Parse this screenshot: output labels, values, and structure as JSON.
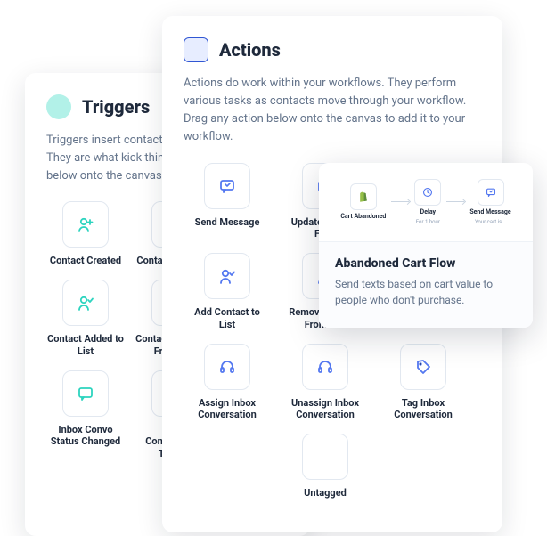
{
  "triggers": {
    "title": "Triggers",
    "desc": "Triggers insert contacts into your workflows. They are what kick things off. Drag any trigger below onto the canvas to add it.",
    "items": [
      {
        "label": "Contact Created",
        "icon": "user-plus"
      },
      {
        "label": "Contact Changed",
        "icon": "user-check"
      },
      {
        "label": "Contact Added to List",
        "icon": "user-check"
      },
      {
        "label": "Contact Removed From List",
        "icon": "user-minus"
      },
      {
        "label": "Inbox Convo Status Changed",
        "icon": "message"
      },
      {
        "label": "Inbox Conversation Tagged",
        "icon": "message-tag"
      }
    ]
  },
  "actions": {
    "title": "Actions",
    "desc": "Actions do work within your workflows. They perform various tasks as contacts move through your workflow. Drag any action below onto the canvas to add it to your workflow.",
    "items": [
      {
        "label": "Send Message",
        "icon": "send-message"
      },
      {
        "label": "Update Contact Field",
        "icon": "edit-field"
      },
      {
        "label": "",
        "icon": ""
      },
      {
        "label": "Add Contact to List",
        "icon": "user-check"
      },
      {
        "label": "Remove Contact From List",
        "icon": "user-minus"
      },
      {
        "label": "",
        "icon": ""
      },
      {
        "label": "Assign Inbox Conversation",
        "icon": "headset"
      },
      {
        "label": "Unassign Inbox Conversation",
        "icon": "headset"
      },
      {
        "label": "Tag Inbox Conversation",
        "icon": "tag"
      },
      {
        "label": "",
        "icon": ""
      },
      {
        "label": "Untagged",
        "icon": ""
      },
      {
        "label": "",
        "icon": ""
      }
    ]
  },
  "flow": {
    "title": "Abandoned Cart Flow",
    "desc": "Send texts based on cart value to people who don't purchase.",
    "nodes": [
      {
        "label": "Cart Abandoned",
        "sub": "",
        "icon": "shopify"
      },
      {
        "label": "Delay",
        "sub": "For 1 hour",
        "icon": "clock"
      },
      {
        "label": "Send Message",
        "sub": "Your cart is...",
        "icon": "send-message"
      }
    ]
  }
}
